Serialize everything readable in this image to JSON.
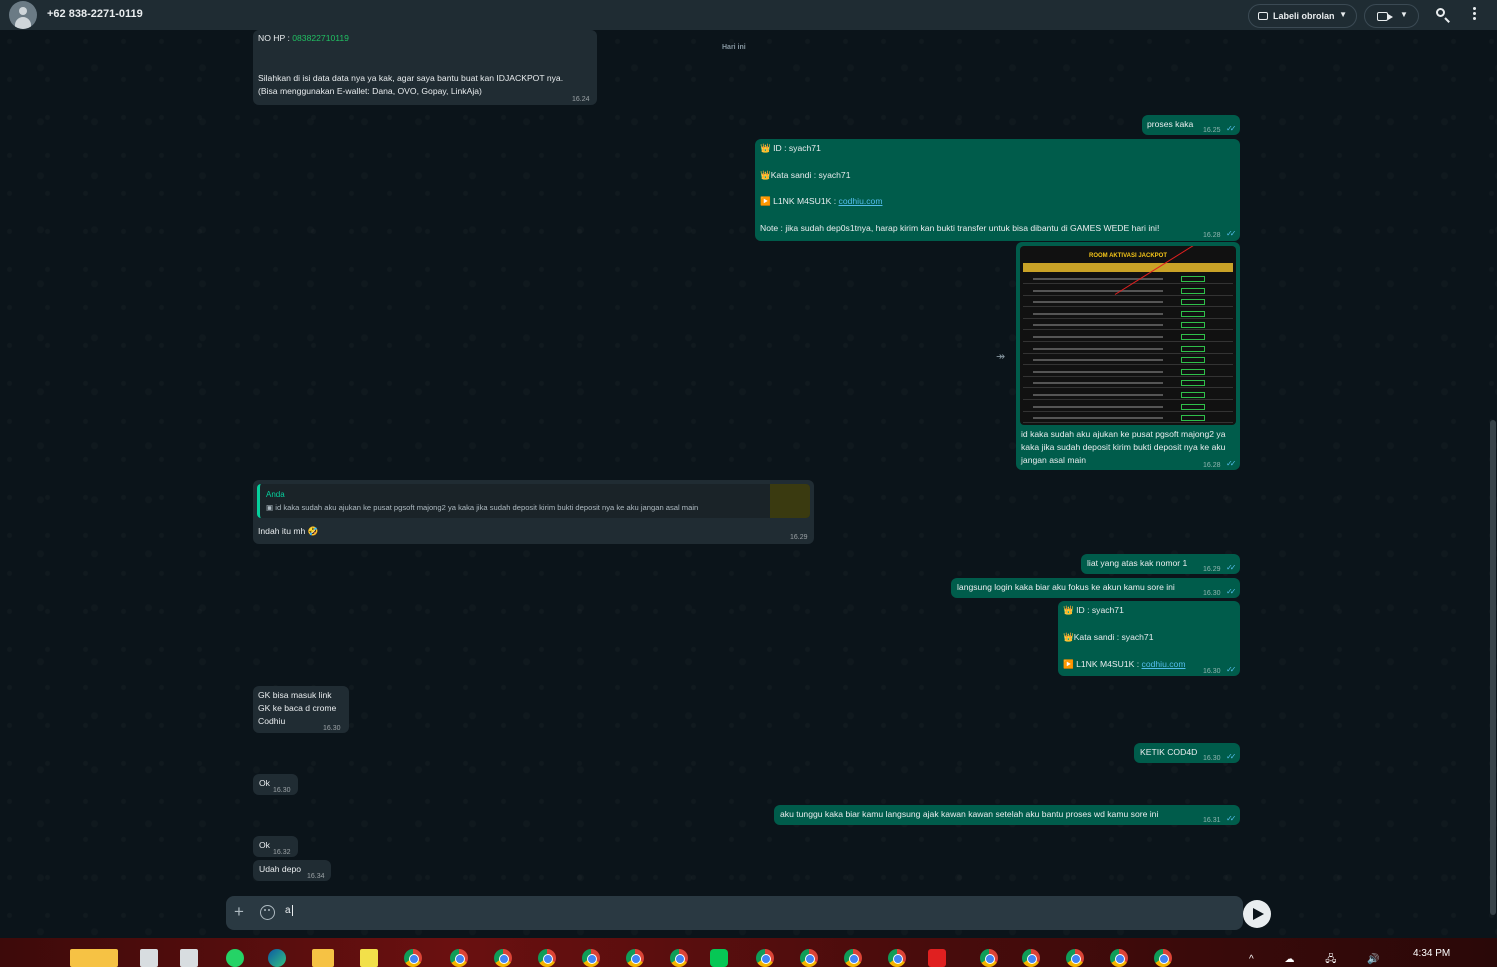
{
  "header": {
    "contact_name": "+62 838-2271-0119",
    "label_button": "Labeli obrolan",
    "icons": [
      "avatar-icon",
      "label-icon",
      "video-call-icon",
      "chevron-down-icon",
      "search-icon",
      "more-menu-icon"
    ]
  },
  "chat": {
    "date_chip": "Hari ini",
    "m1": {
      "phone_label": "NO HP :",
      "phone_value": "083822710119",
      "text": "Silahkan di isi data data nya ya kak, agar saya bantu buat kan IDJACKPOT nya.\n(Bisa menggunakan E-wallet: Dana, OVO, Gopay, LinkAja)",
      "time": "16.24"
    },
    "m2": {
      "text": "proses kaka",
      "time": "16.25"
    },
    "m3": {
      "line1": "👑 ID :  syach71",
      "line2": "👑Kata sandi : syach71",
      "line3_prefix": "▶️ L1NK M4SU1K :",
      "link": "codhiu.com",
      "note": "Note : jika sudah dep0s1tnya, harap kirim kan bukti transfer untuk bisa dibantu di GAMES WEDE hari ini!",
      "time": "16.28"
    },
    "m4": {
      "image_title": "ROOM AKTIVASI JACKPOT",
      "caption": "id kaka sudah aku ajukan ke pusat pgsoft majong2 ya kaka jika sudah deposit kirim bukti deposit nya ke aku jangan asal main",
      "time": "16.28"
    },
    "m5": {
      "quote_author": "Anda",
      "quote_text": "id kaka sudah aku ajukan ke pusat pgsoft majong2 ya kaka jika sudah deposit kirim bukti deposit nya ke aku jangan asal main",
      "text": "Indah itu mh 🤣",
      "time": "16.29"
    },
    "m6": {
      "text": "liat yang atas kak nomor 1",
      "time": "16.29"
    },
    "m7": {
      "text": "langsung login kaka biar aku fokus ke akun kamu sore ini",
      "time": "16.30"
    },
    "m8": {
      "line1": "👑 ID :  syach71",
      "line2": "👑Kata sandi : syach71",
      "line3_prefix": "▶️ L1NK M4SU1K :",
      "link": "codhiu.com",
      "time": "16.30"
    },
    "m9": {
      "text": "GK bisa masuk link\nGK ke baca d crome\nCodhiu",
      "time": "16.30"
    },
    "m10": {
      "text": "KETIK COD4D",
      "time": "16.30"
    },
    "m11": {
      "text": "Ok",
      "time": "16.30"
    },
    "m12": {
      "text": "aku tunggu kaka biar kamu langsung ajak kawan kawan setelah aku bantu proses wd kamu sore ini",
      "time": "16.31"
    },
    "m13": {
      "text": "Ok",
      "time": "16.32"
    },
    "m14": {
      "text": "Udah depo",
      "time": "16.34"
    }
  },
  "composer": {
    "value": "a",
    "icons": [
      "plus-icon",
      "sticker-icon",
      "send-icon"
    ]
  },
  "taskbar": {
    "clock": "4:34 PM",
    "tray": "^ ☁ 🖧 🔊",
    "icons": [
      "chrome-icon",
      "whatsapp-icon",
      "edge-icon",
      "folder-icon",
      "line-icon",
      "wps-icon"
    ]
  },
  "colors": {
    "incoming_bubble": "#202c33",
    "outgoing_bubble": "#005c4b",
    "link": "#53bdeb",
    "quote_accent": "#06cf9c"
  }
}
